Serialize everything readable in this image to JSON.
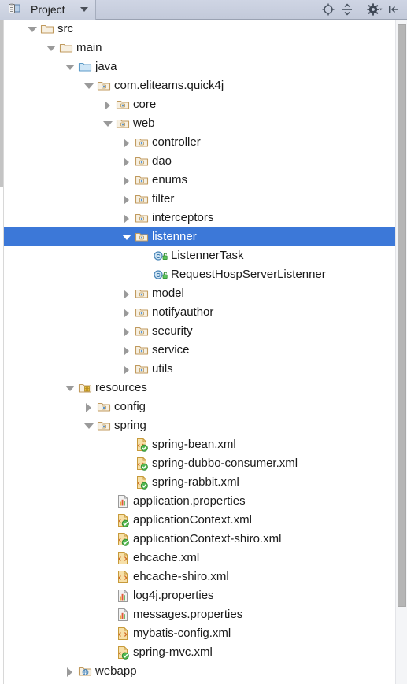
{
  "window": {
    "tool_tab": {
      "label": "Project",
      "icon": "project-view-icon",
      "dropdown_icon": "chevron-down-icon"
    },
    "actions": [
      {
        "name": "locate-icon",
        "title": "Select Opened File"
      },
      {
        "name": "collapse-all-icon",
        "title": "Collapse All"
      },
      {
        "name": "settings-gear-icon",
        "title": "Settings"
      },
      {
        "name": "hide-icon",
        "title": "Hide"
      }
    ]
  },
  "tree": {
    "selected_index": 11,
    "rows": [
      {
        "label": "src",
        "depth": 1,
        "arrow": "expanded",
        "icon": "folder-plain"
      },
      {
        "label": "main",
        "depth": 2,
        "arrow": "expanded",
        "icon": "folder-plain"
      },
      {
        "label": "java",
        "depth": 3,
        "arrow": "expanded",
        "icon": "folder-source"
      },
      {
        "label": "com.eliteams.quick4j",
        "depth": 4,
        "arrow": "expanded",
        "icon": "folder-package"
      },
      {
        "label": "core",
        "depth": 5,
        "arrow": "collapsed",
        "icon": "folder-package"
      },
      {
        "label": "web",
        "depth": 5,
        "arrow": "expanded",
        "icon": "folder-package"
      },
      {
        "label": "controller",
        "depth": 6,
        "arrow": "collapsed",
        "icon": "folder-package"
      },
      {
        "label": "dao",
        "depth": 6,
        "arrow": "collapsed",
        "icon": "folder-package"
      },
      {
        "label": "enums",
        "depth": 6,
        "arrow": "collapsed",
        "icon": "folder-package"
      },
      {
        "label": "filter",
        "depth": 6,
        "arrow": "collapsed",
        "icon": "folder-package"
      },
      {
        "label": "interceptors",
        "depth": 6,
        "arrow": "collapsed",
        "icon": "folder-package"
      },
      {
        "label": "listenner",
        "depth": 6,
        "arrow": "expanded",
        "icon": "folder-package"
      },
      {
        "label": "ListennerTask",
        "depth": 7,
        "arrow": "none",
        "icon": "java-class"
      },
      {
        "label": "RequestHospServerListenner",
        "depth": 7,
        "arrow": "none",
        "icon": "java-class"
      },
      {
        "label": "model",
        "depth": 6,
        "arrow": "collapsed",
        "icon": "folder-package"
      },
      {
        "label": "notifyauthor",
        "depth": 6,
        "arrow": "collapsed",
        "icon": "folder-package"
      },
      {
        "label": "security",
        "depth": 6,
        "arrow": "collapsed",
        "icon": "folder-package"
      },
      {
        "label": "service",
        "depth": 6,
        "arrow": "collapsed",
        "icon": "folder-package"
      },
      {
        "label": "utils",
        "depth": 6,
        "arrow": "collapsed",
        "icon": "folder-package"
      },
      {
        "label": "resources",
        "depth": 3,
        "arrow": "expanded",
        "icon": "folder-resource"
      },
      {
        "label": "config",
        "depth": 4,
        "arrow": "collapsed",
        "icon": "folder-package"
      },
      {
        "label": "spring",
        "depth": 4,
        "arrow": "expanded",
        "icon": "folder-package"
      },
      {
        "label": "spring-bean.xml",
        "depth": 6,
        "arrow": "none",
        "icon": "xml-spring"
      },
      {
        "label": "spring-dubbo-consumer.xml",
        "depth": 6,
        "arrow": "none",
        "icon": "xml-spring"
      },
      {
        "label": "spring-rabbit.xml",
        "depth": 6,
        "arrow": "none",
        "icon": "xml-spring"
      },
      {
        "label": "application.properties",
        "depth": 5,
        "arrow": "none",
        "icon": "properties"
      },
      {
        "label": "applicationContext.xml",
        "depth": 5,
        "arrow": "none",
        "icon": "xml-spring"
      },
      {
        "label": "applicationContext-shiro.xml",
        "depth": 5,
        "arrow": "none",
        "icon": "xml-spring"
      },
      {
        "label": "ehcache.xml",
        "depth": 5,
        "arrow": "none",
        "icon": "xml-plain"
      },
      {
        "label": "ehcache-shiro.xml",
        "depth": 5,
        "arrow": "none",
        "icon": "xml-plain"
      },
      {
        "label": "log4j.properties",
        "depth": 5,
        "arrow": "none",
        "icon": "properties"
      },
      {
        "label": "messages.properties",
        "depth": 5,
        "arrow": "none",
        "icon": "properties"
      },
      {
        "label": "mybatis-config.xml",
        "depth": 5,
        "arrow": "none",
        "icon": "xml-plain"
      },
      {
        "label": "spring-mvc.xml",
        "depth": 5,
        "arrow": "none",
        "icon": "xml-spring"
      },
      {
        "label": "webapp",
        "depth": 3,
        "arrow": "collapsed",
        "icon": "folder-web"
      }
    ]
  },
  "colors": {
    "selection": "#3c78d8",
    "toolbar": "#c9d0e0",
    "folder": "#c6a06a",
    "folder_source": "#6aa6d6",
    "text": "#1a1a1a"
  }
}
